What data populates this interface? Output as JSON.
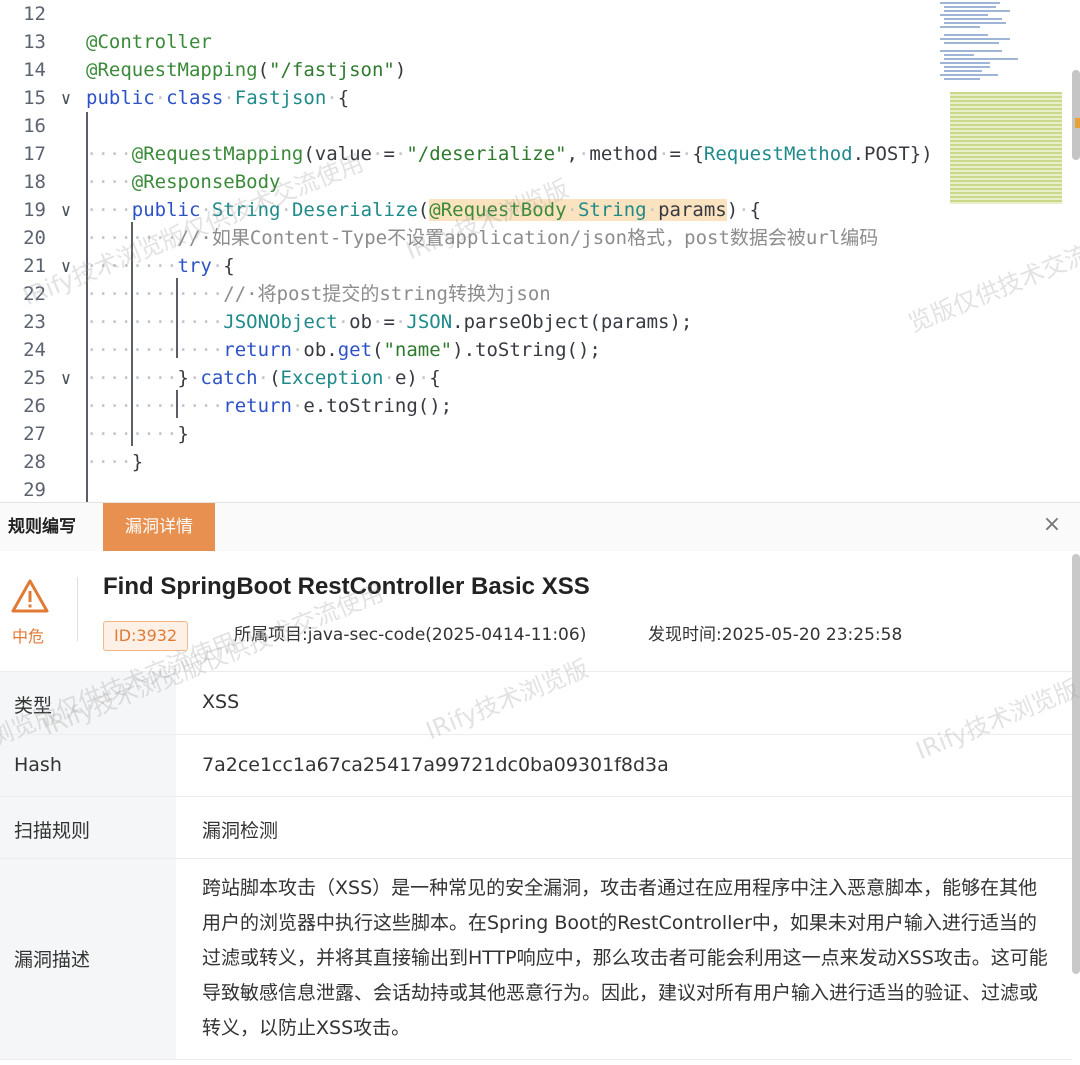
{
  "editor": {
    "lines": [
      {
        "n": "12",
        "fold": "",
        "html": ""
      },
      {
        "n": "13",
        "fold": "",
        "html": "<span class=\"ann\">@Controller</span>"
      },
      {
        "n": "14",
        "fold": "",
        "html": "<span class=\"ann\">@RequestMapping</span>(<span class=\"str\">\"/fastjson\"</span>)"
      },
      {
        "n": "15",
        "fold": "∨",
        "html": "<span class=\"kw\">public</span><span class=\"dot\">·</span><span class=\"kw\">class</span><span class=\"dot\">·</span><span class=\"cls\">Fastjson</span><span class=\"dot\">·</span>{"
      },
      {
        "n": "16",
        "fold": "",
        "html": ""
      },
      {
        "n": "17",
        "fold": "",
        "html": "<span class=\"dot\">····</span><span class=\"ann\">@RequestMapping</span>(value<span class=\"dot\">·</span>=<span class=\"dot\">·</span><span class=\"str\">\"/deserialize\"</span>,<span class=\"dot\">·</span>method<span class=\"dot\">·</span>=<span class=\"dot\">·</span>{<span class=\"cls\">RequestMethod</span>.POST})"
      },
      {
        "n": "18",
        "fold": "",
        "html": "<span class=\"dot\">····</span><span class=\"ann\">@ResponseBody</span>"
      },
      {
        "n": "19",
        "fold": "∨",
        "html": "<span class=\"dot\">····</span><span class=\"kw\">public</span><span class=\"dot\">·</span><span class=\"cls\">String</span><span class=\"dot\">·</span><span class=\"cls\">Deserialize</span>(<span class=\"hl\"><span class=\"ann\">@RequestBody</span><span class=\"dot\">·</span><span class=\"cls\">String</span><span class=\"dot\">·</span>params</span>)<span class=\"dot\">·</span>{"
      },
      {
        "n": "20",
        "fold": "",
        "html": "<span class=\"dot\">········</span><span class=\"cm\">//·如果Content-Type不设置application/json格式，post数据会被url编码</span>"
      },
      {
        "n": "21",
        "fold": "∨",
        "html": "<span class=\"dot\">········</span><span class=\"kw\">try</span><span class=\"dot\">·</span>{"
      },
      {
        "n": "22",
        "fold": "",
        "html": "<span class=\"dot\">············</span><span class=\"cm\">//·将post提交的string转换为json</span>"
      },
      {
        "n": "23",
        "fold": "",
        "html": "<span class=\"dot\">············</span><span class=\"cls\">JSONObject</span><span class=\"dot\">·</span>ob<span class=\"dot\">·</span>=<span class=\"dot\">·</span><span class=\"cls\">JSON</span>.parseObject(params);"
      },
      {
        "n": "24",
        "fold": "",
        "html": "<span class=\"dot\">············</span><span class=\"kw\">return</span><span class=\"dot\">·</span>ob.<span class=\"kw\">get</span>(<span class=\"str\">\"name\"</span>).toString();"
      },
      {
        "n": "25",
        "fold": "∨",
        "html": "<span class=\"dot\">········</span>}<span class=\"dot\">·</span><span class=\"kw\">catch</span><span class=\"dot\">·</span>(<span class=\"cls\">Exception</span><span class=\"dot\">·</span>e)<span class=\"dot\">·</span>{"
      },
      {
        "n": "26",
        "fold": "",
        "html": "<span class=\"dot\">············</span><span class=\"kw\">return</span><span class=\"dot\">·</span>e.toString();"
      },
      {
        "n": "27",
        "fold": "",
        "html": "<span class=\"dot\">········</span>}"
      },
      {
        "n": "28",
        "fold": "",
        "html": "<span class=\"dot\">····</span>}"
      },
      {
        "n": "29",
        "fold": "",
        "html": ""
      }
    ]
  },
  "panel": {
    "tab_rules": "规则编写",
    "tab_detail": "漏洞详情",
    "close_glyph": "×",
    "severity": "中危",
    "title": "Find SpringBoot RestController Basic XSS",
    "id": "ID:3932",
    "project": "所属项目:java-sec-code(2025-0414-11:06)",
    "found_time": "发现时间:2025-05-20 23:25:58",
    "rows": {
      "type_key": "类型",
      "type_val": "XSS",
      "hash_key": "Hash",
      "hash_val": "7a2ce1cc1a67ca25417a99721dc0ba09301f8d3a",
      "rule_key": "扫描规则",
      "rule_val": "漏洞检测",
      "desc_key": "漏洞描述",
      "desc_val": "跨站脚本攻击（XSS）是一种常见的安全漏洞，攻击者通过在应用程序中注入恶意脚本，能够在其他用户的浏览器中执行这些脚本。在Spring Boot的RestController中，如果未对用户输入进行适当的过滤或转义，并将其直接输出到HTTP响应中，那么攻击者可能会利用这一点来发动XSS攻击。这可能导致敏感信息泄露、会话劫持或其他恶意行为。因此，建议对所有用户输入进行适当的验证、过滤或转义，以防止XSS攻击。"
    }
  },
  "watermarks": [
    "IRify技术浏览版仅供技术交流使用",
    "IRify技术浏览版",
    "览版仅供技术交流使用",
    "IRify技术浏览版仅供技术交流使用",
    "IRify技术浏览版",
    "浏览版仅供技术交流使用",
    "IRify技术浏览版"
  ],
  "colors": {
    "accent": "#e8904f",
    "annotation": "#3a8a3a",
    "keyword": "#2d52c8",
    "string": "#2f7a2f"
  }
}
